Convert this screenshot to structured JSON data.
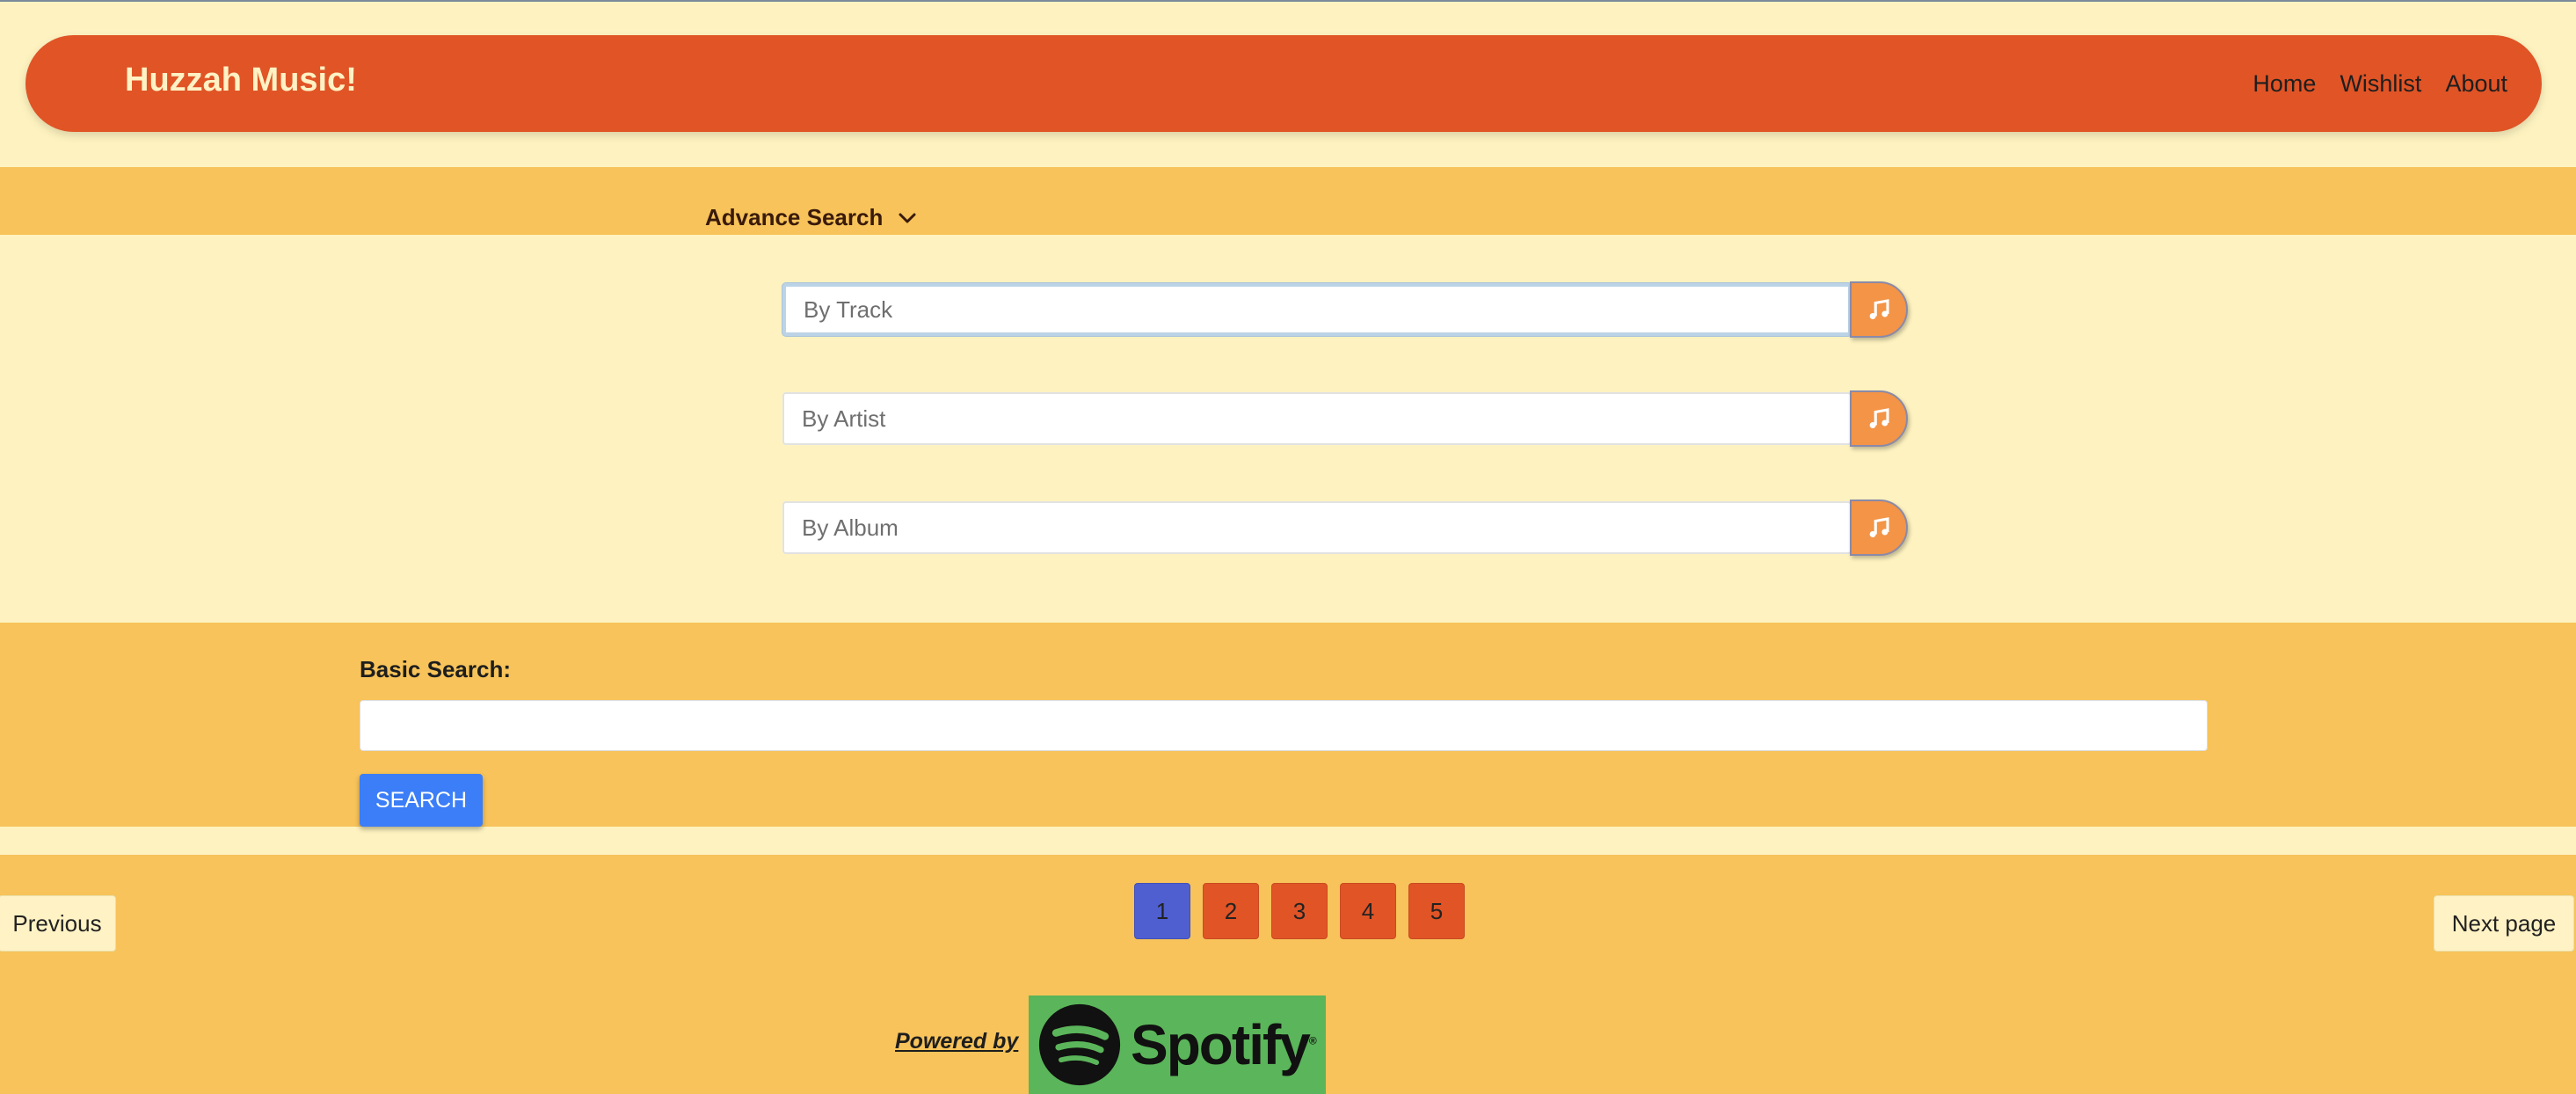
{
  "header": {
    "brand": "Huzzah Music!",
    "nav": [
      "Home",
      "Wishlist",
      "About"
    ]
  },
  "advanced_search": {
    "toggle_label": "Advance Search",
    "toggle_icon": "chevron-down-icon",
    "fields": [
      {
        "placeholder": "By Track",
        "value": "",
        "button_icon": "music-note-icon"
      },
      {
        "placeholder": "By Artist",
        "value": "",
        "button_icon": "music-note-icon"
      },
      {
        "placeholder": "By Album",
        "value": "",
        "button_icon": "music-note-icon"
      }
    ]
  },
  "basic_search": {
    "label": "Basic Search:",
    "value": "",
    "button_label": "SEARCH"
  },
  "pagination": {
    "previous_label": "Previous",
    "next_label": "Next page",
    "pages": [
      "1",
      "2",
      "3",
      "4",
      "5"
    ],
    "current_page": "1"
  },
  "footer": {
    "powered_by": "Powered by ",
    "logo_text": "Spotify",
    "logo_mark": "®"
  },
  "colors": {
    "navbar": "#e05426",
    "band": "#f7c35a",
    "background": "#fef3c0",
    "search_button": "#3b7ef7",
    "music_button": "#f39447",
    "active_page": "#4f5fd0",
    "spotify_green": "#5bb55a"
  }
}
